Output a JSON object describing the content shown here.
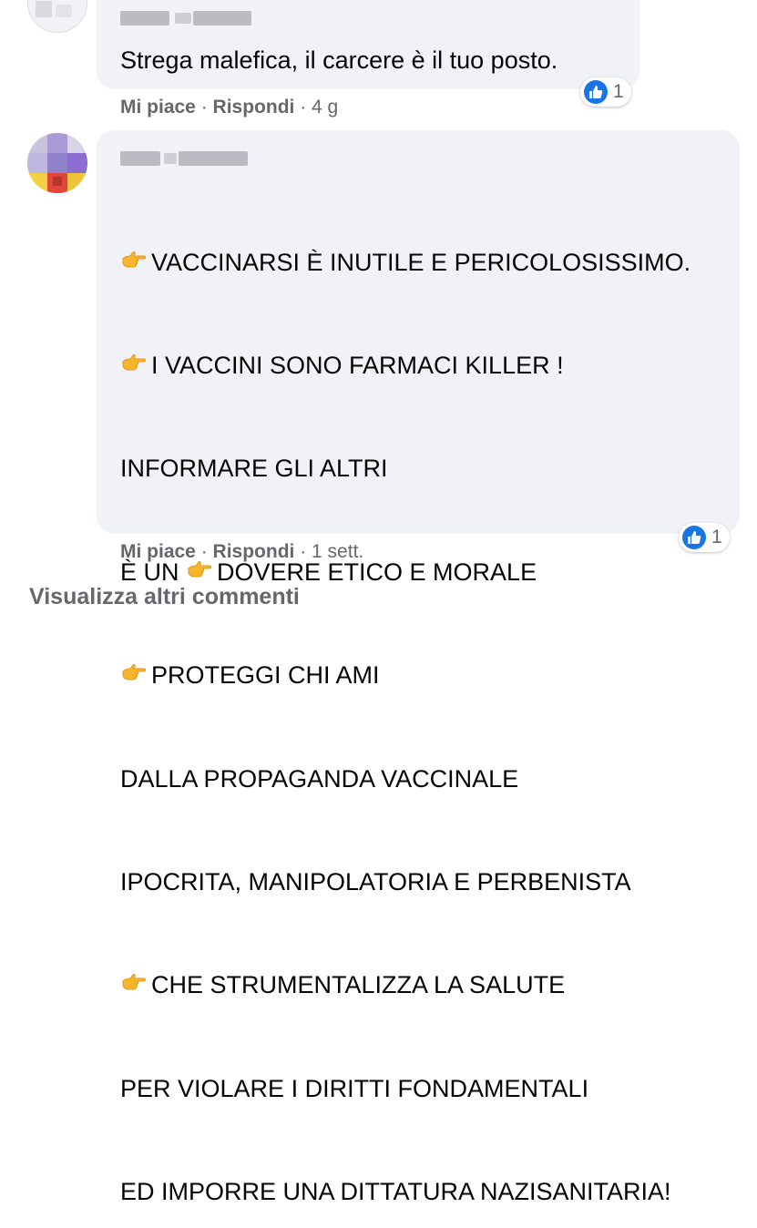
{
  "comments": [
    {
      "author": "",
      "text_lines": [
        "Stregа malefica, il carcere è il tuo posto."
      ],
      "actions": {
        "like": "Mi piace",
        "sep1": " · ",
        "reply": "Rispondi",
        "sep2": " · ",
        "time": "4 g"
      },
      "reactions": {
        "icon": "like-icon",
        "count": "1"
      }
    },
    {
      "author": "",
      "lines": [
        {
          "emoji": true,
          "text": "VACCINARSI È INUTILE E PERICOLOSISSIMO."
        },
        {
          "emoji": true,
          "text": "I VACCINI SONO FARMACI KILLER !"
        },
        {
          "emoji": false,
          "text": "INFORMARE GLI ALTRI"
        },
        {
          "emoji_inline": true,
          "before": "È UN ",
          "text": "DOVERE ETICO E MORALE"
        },
        {
          "emoji": true,
          "text": "PROTEGGI CHI AMI"
        },
        {
          "emoji": false,
          "text": "DALLA PROPAGANDA VACCINALE"
        },
        {
          "emoji": false,
          "text": "IPOCRITA, MANIPOLATORIA E PERBENISTA"
        },
        {
          "emoji": true,
          "text": "CHE STRUMENTALIZZA LA SALUTE"
        },
        {
          "emoji": false,
          "text": "PER VIOLARE I DIRITTI FONDAMENTALI"
        },
        {
          "emoji": false,
          "text": "ED IMPORRE UNA DITTATURA NAZISANITARIA!"
        }
      ],
      "actions": {
        "like": "Mi piace",
        "sep1": " · ",
        "reply": "Rispondi",
        "sep2": " · ",
        "time": "1 sett."
      },
      "reactions": {
        "icon": "like-icon",
        "count": "1"
      }
    }
  ],
  "view_more": "Visualizza altri commenti",
  "colors": {
    "bubble": "#f0f2f5",
    "secondary_text": "#65676b",
    "like_blue": "#1b74e4",
    "emoji_yellow": "#f7b52c"
  }
}
